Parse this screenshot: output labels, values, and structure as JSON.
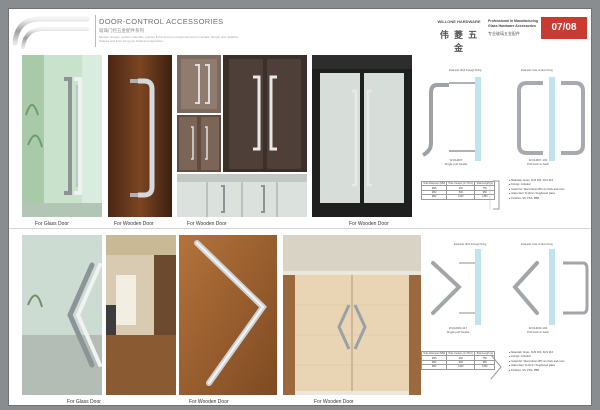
{
  "header": {
    "title": "DOOR-CONTROL ACCESSORIES",
    "subtitle": "玻璃门控五金配件系列",
    "description": "Modern shapes, perfect materials, precise finish and an exceptional care for details. Simple and reliability. Shapes and lines bring you limitless imagination.",
    "brand_en": "WILLONE HARDWARE",
    "brand_cn": "伟 菱 五 金",
    "tagline_en": "Professional In Manufacturing Glass Hardware Accessories",
    "tagline_cn": "专业玻璃五金配件",
    "page_number": "07/08"
  },
  "top": {
    "captions": [
      "For Glass Door",
      "For Wooden Door",
      "For Wooden Door"
    ],
    "diagram_left_title": "Example: Bolt through fixing",
    "diagram_right_title": "Example: face to face fixing",
    "model_left": "W-DH607",
    "model_left_note": "Single pull handle",
    "model_right": "W-DH607-102",
    "model_right_note": "Pull back to back",
    "table": {
      "headers": [
        "Tube Diameter (MM)",
        "Hole Centers (C-TO-C)",
        "Total Length (L)"
      ],
      "rows": [
        [
          "Ø25",
          "600",
          "750"
        ],
        [
          "Ø32",
          "800",
          "950"
        ],
        [
          "Ø32",
          "1200",
          "1350"
        ]
      ]
    },
    "features": [
      "Materials: brass, SUS 304, SUS 316",
      "Fixings: included",
      "Suited for: Wood doors Ø5 mm thick and more",
      "Glass door: 8-13mm Toughened glass",
      "Finishes: SS, PSS, PBB"
    ]
  },
  "bottom": {
    "captions": [
      "For Glass Door",
      "For Wooden Door",
      "For Wooden Door"
    ],
    "diagram_left_title": "Example: Bolt through fixing",
    "diagram_right_title": "Example: face to face fixing",
    "model_left": "W-DH000-117",
    "model_left_note": "Single pull handle",
    "model_right": "W-DH000-102",
    "model_right_note": "Pull back to back",
    "table": {
      "headers": [
        "Tube Diameter (MM)",
        "Hole Centers (C-TO-C)",
        "Total Length (L)"
      ],
      "rows": [
        [
          "Ø25",
          "600",
          "750"
        ],
        [
          "Ø32",
          "800",
          "950"
        ],
        [
          "Ø32",
          "1200",
          "1350"
        ]
      ]
    },
    "features": [
      "Materials: brass, SUS 304, SUS 316",
      "Fixings: included",
      "Suited for: Wood doors Ø5 mm thick and more",
      "Glass door: 8-13mm Toughened glass",
      "Finishes: SS, PSS, PBB"
    ]
  },
  "colors": {
    "accent": "#c93a31",
    "steel": "#c6cacd",
    "wood": "#8a4e22",
    "glass": "#cfe7d2"
  }
}
